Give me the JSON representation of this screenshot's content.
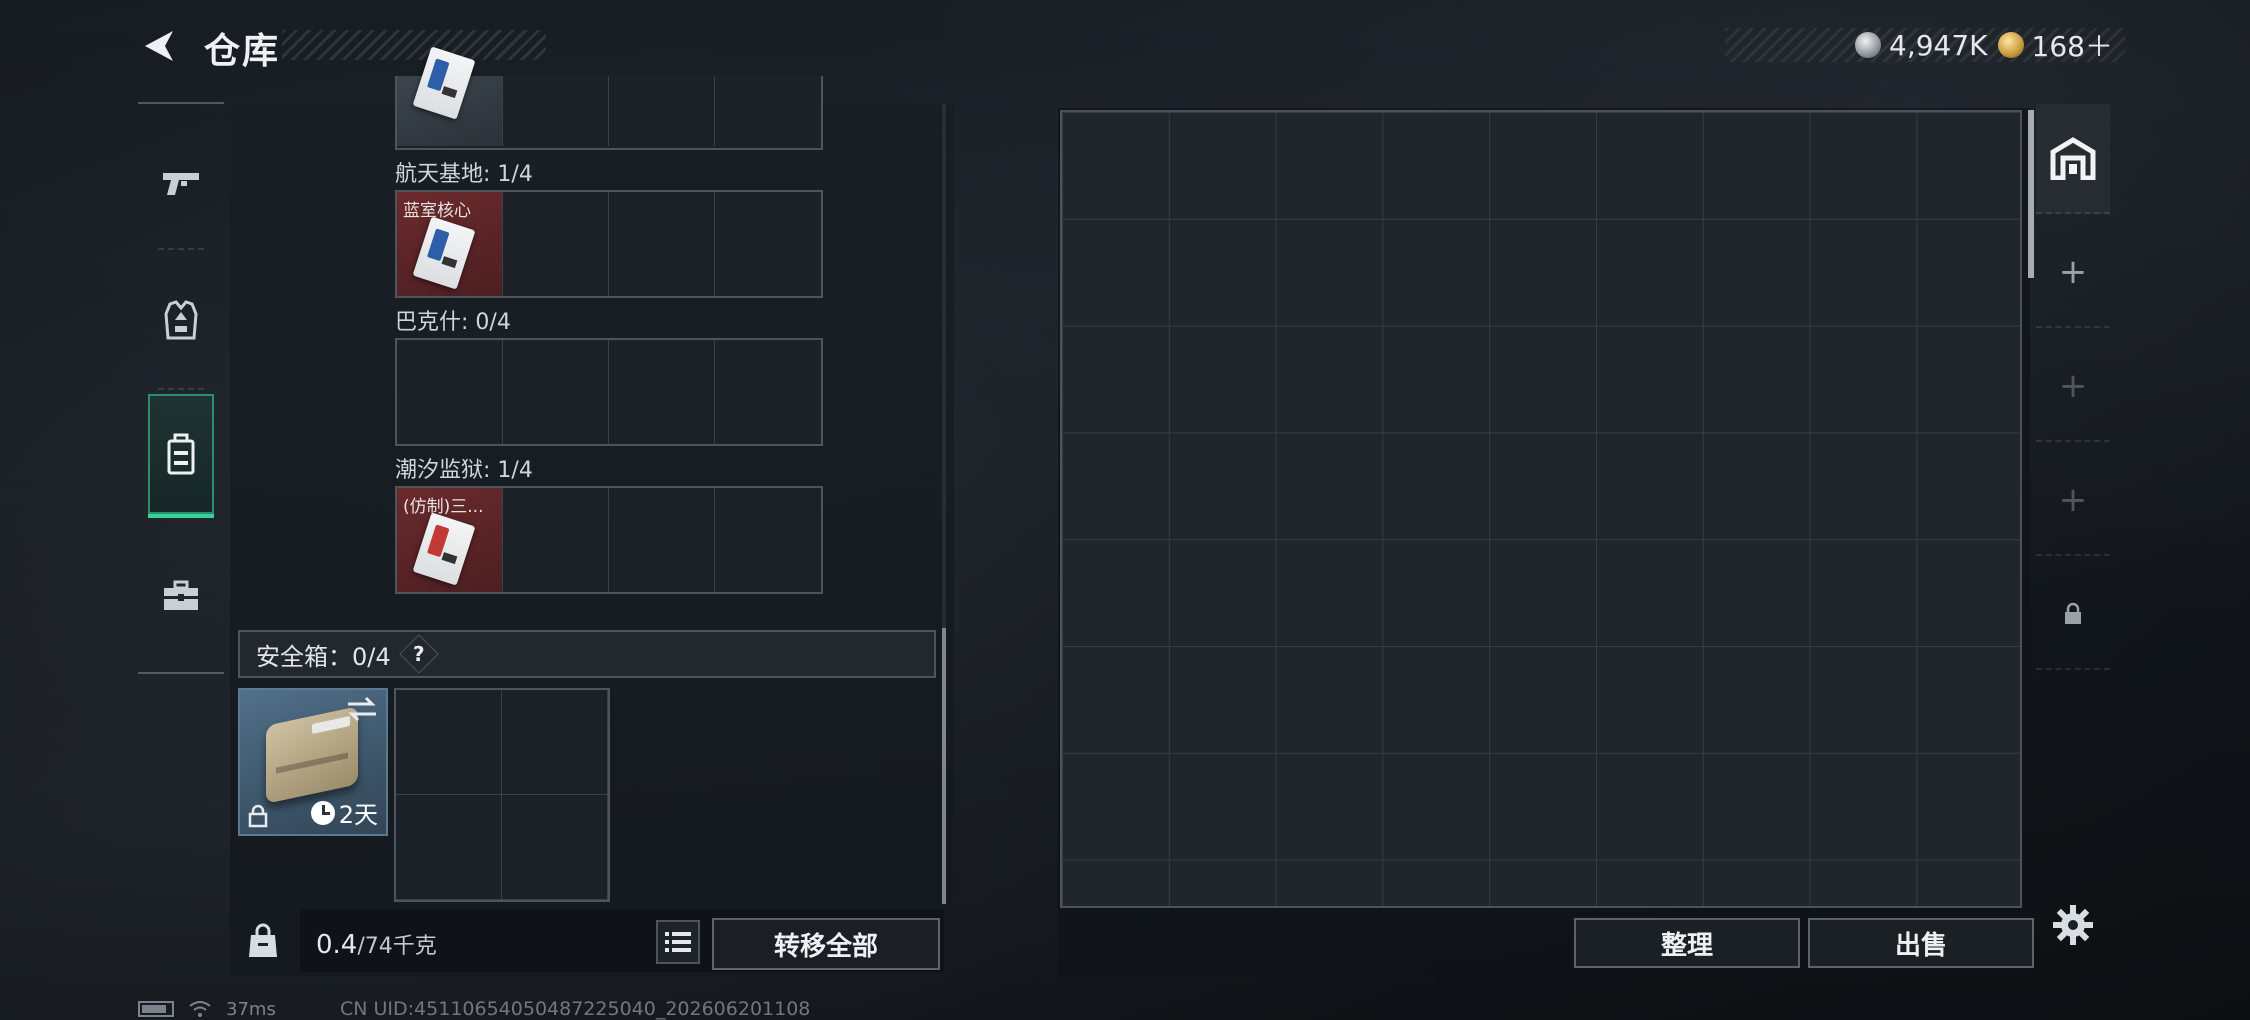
{
  "header": {
    "title": "仓库",
    "currency": [
      {
        "icon": "silver-coin-icon",
        "value": "4,947K"
      },
      {
        "icon": "gold-coin-icon",
        "value": "168＋"
      }
    ]
  },
  "left_rail": {
    "items": [
      {
        "name": "weapon-tab",
        "icon": "pistol-icon",
        "active": false
      },
      {
        "name": "armor-tab",
        "icon": "vest-icon",
        "active": false
      },
      {
        "name": "backpack-tab",
        "icon": "backpack-icon",
        "active": true
      },
      {
        "name": "case-tab",
        "icon": "toolbox-icon",
        "active": false
      }
    ]
  },
  "key_slots": [
    {
      "title": "航天基地: 1/4",
      "item_label": "蓝室核心"
    },
    {
      "title": "巴克什: 0/4",
      "item_label": ""
    },
    {
      "title": "潮汐监狱: 1/4",
      "item_label": "(仿制)三..."
    }
  ],
  "safe_box": {
    "label": "安全箱：0/4",
    "help": "?",
    "timer": "2天"
  },
  "weight": {
    "current": "0.4",
    "capacity": "/74千克"
  },
  "buttons": {
    "transfer_all": "转移全部",
    "sort": "整理",
    "sell": "出售"
  },
  "right_tabs": [
    {
      "name": "stash-tab",
      "icon": "stash-icon",
      "glyph": "",
      "active": true
    },
    {
      "name": "add-tab-1",
      "icon": "plus-icon",
      "glyph": "+",
      "active": false
    },
    {
      "name": "add-tab-2",
      "icon": "plus-icon",
      "glyph": "+",
      "active": false
    },
    {
      "name": "add-tab-3",
      "icon": "plus-icon",
      "glyph": "+",
      "active": false
    },
    {
      "name": "locked-tab",
      "icon": "lock-icon",
      "glyph": "",
      "active": false
    }
  ],
  "status_bar": {
    "ping": "37ms",
    "uid": "CN UID:45110654050487225040_202606201108"
  },
  "colors": {
    "accent_green": "#33d39b",
    "item_red": "#6b2a2c",
    "safe_box_blue": "#51708a"
  }
}
